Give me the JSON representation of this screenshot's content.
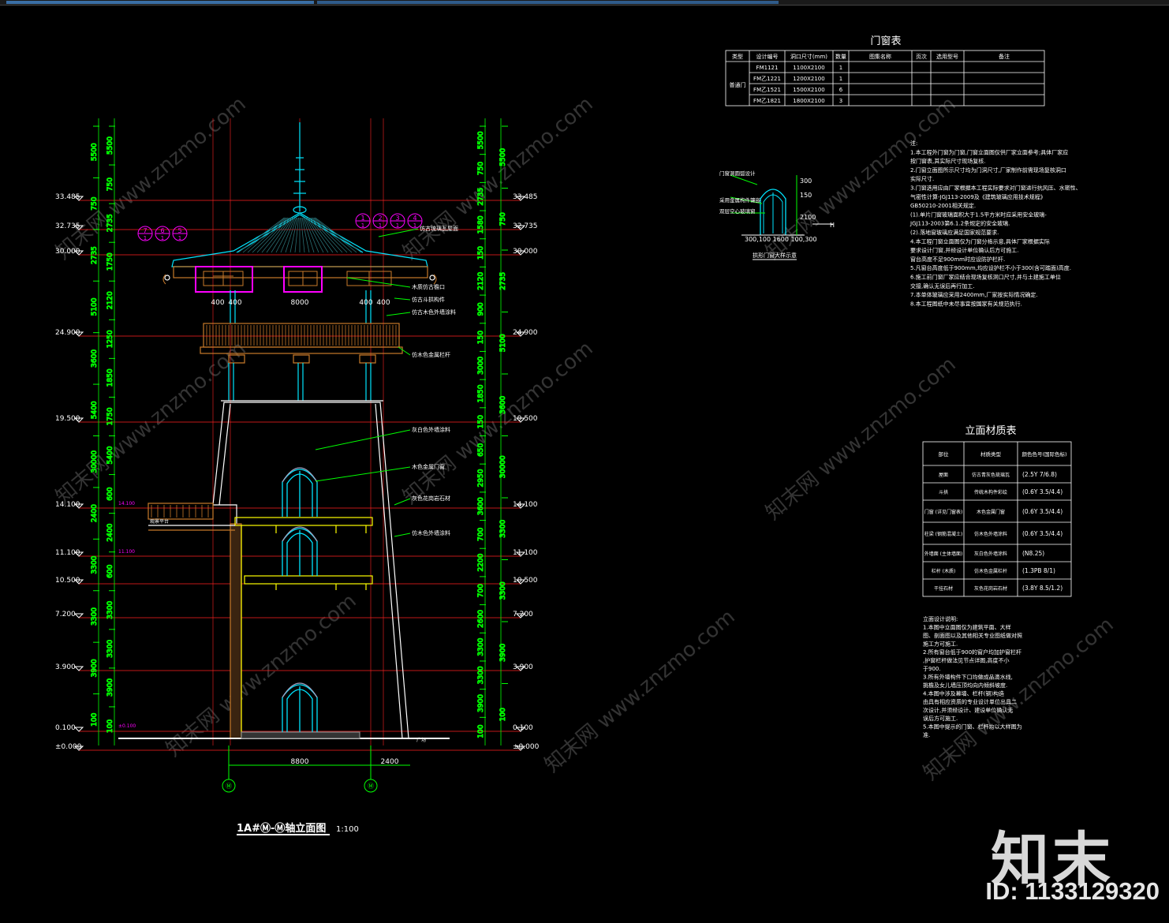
{
  "drawing_title": "1A#Ⓜ-Ⓜ轴立面图",
  "drawing_scale": "1:100",
  "door_table": {
    "title": "门窗表",
    "headers": [
      "类型",
      "设计编号",
      "洞口尺寸(mm)",
      "数量",
      "图集名称",
      "页次",
      "选用型号",
      "备注"
    ],
    "type": "普通门",
    "rows": [
      {
        "code": "FM1121",
        "size": "1100X2100",
        "qty": "1"
      },
      {
        "code": "FM乙1221",
        "size": "1200X2100",
        "qty": "1"
      },
      {
        "code": "FM乙1521",
        "size": "1500X2100",
        "qty": "6"
      },
      {
        "code": "FM乙1821",
        "size": "1800X2100",
        "qty": "3"
      }
    ]
  },
  "door_detail": {
    "title": "拱形门窗大样示意",
    "label_top": "门窗洞圆弧设计",
    "label_mid": "采用金属构件镶嵌",
    "label_low": "双层空心玻璃窗",
    "dims_bottom": "300,100 1600 100,300",
    "dims_right": [
      "300",
      "150",
      "2100"
    ],
    "h_mark": "H"
  },
  "notes": {
    "lines": [
      "注:",
      "1.本工程外门窗为门窗,门窗立面图仅供厂家立面参考;具体厂家应",
      "  按门窗表,其实际尺寸现场复核.",
      "2.门窗立面图所示尺寸均为门洞尺寸,厂家制作前需现场复核洞口",
      "  实际尺寸.",
      "3.门窗选用应由厂家根据本工程实际要求对门窗进行抗风压、水密性、",
      "  气密性计算-JGJ113-2009及《建筑玻璃应用技术规程》",
      "  GB50210-2001相关规定.",
      "  (1).单片门窗玻璃面积大于1.5平方米时应采用安全玻璃-",
      "  JGJ113-2003第6.1.2条规定的安全玻璃.",
      "  (2).落地窗玻璃应满足国家规范要求.",
      "4.本工程门窗立面图仅为门窗分格示意,具体厂家根据实际",
      "  要求设计门窗,并经设计单位确认后方可施工.",
      "  窗台高度不足900mm时应设防护栏杆.",
      "5.凡窗台高度低于900mm,均应设护栏不小于300(含可踏面)高度.",
      "6.施工前门窗厂家应结合现场复核洞口尺寸,并与土建施工单位",
      "  交接,确认无误后再行加工.",
      "7.本单体玻璃应采用2400mm,厂家按实际情况确定.",
      "8.本工程图纸中未尽事宜按国家有关规范执行."
    ]
  },
  "material_table": {
    "title": "立面材质表",
    "headers": [
      "部位",
      "材质类型",
      "颜色色号(国际色标)"
    ],
    "rows": [
      {
        "part": "屋面",
        "material": "仿古青灰色琉璃瓦",
        "color": "(2.5Y 7/6.8)"
      },
      {
        "part": "斗拱",
        "material": "传统木构件彩绘",
        "color": "(0.6Y 3.5/4.4)"
      },
      {
        "part": "门窗 (详见门窗表)",
        "material": "木色金属门窗",
        "color": "(0.6Y 3.5/4.4)"
      },
      {
        "part": "柱梁 (钢筋混凝土)",
        "material": "仿木色外墙涂料",
        "color": "(0.6Y 3.5/4.4)"
      },
      {
        "part": "外墙面 (主体墙面)",
        "material": "灰白色外墙涂料",
        "color": "(N8.25)"
      },
      {
        "part": "栏杆 (木质)",
        "material": "仿木色金属栏杆",
        "color": "(1.3PB 8/1)"
      },
      {
        "part": "干挂石材",
        "material": "灰色花岗岩石材",
        "color": "(3.8Y 8.5/1.2)"
      }
    ]
  },
  "design_notes": {
    "lines": [
      "立面设计说明:",
      "1.本图中立面图仅为建筑平面、大样",
      "图、剖面图以及其他相关专业图纸做对照",
      "施工方可施工.",
      "2.所有窗台低于900的窗户均加护窗栏杆",
      ",护窗栏杆做法见节点详图,高度不小",
      "于900.",
      "3.所有外墙构件下口均做成品滴水线,",
      "挑檐及女儿墙压顶均向内倾斜坡度.",
      "4.本图中涉及幕墙、栏杆(钢)构造",
      "由具有相应资质的专业设计单位出具二",
      "次设计,并须经设计、建设单位确认无",
      "误后方可施工.",
      "5.本图中提示的门窗、栏杆均以大样图为",
      "准."
    ]
  },
  "elevation": {
    "levels_left": [
      "33.485",
      "32.735",
      "30.000",
      "24.900",
      "19.500",
      "14.100",
      "11.100",
      "10.500",
      "7.200",
      "3.900",
      "0.100",
      "±0.000"
    ],
    "levels_right": [
      "33.485",
      "32.735",
      "30.000",
      "24.900",
      "19.500",
      "14.100",
      "11.100",
      "10.500",
      "7.200",
      "3.900",
      "0.100",
      "±0.000"
    ],
    "dims_left_outer": [
      "5500",
      "750",
      "2735",
      "5100",
      "3600",
      "5400",
      "30000",
      "2400",
      "3300",
      "3300",
      "3900",
      "100"
    ],
    "dims_left_inner": [
      "5500",
      "750",
      "2735",
      "1750",
      "2120",
      "1250",
      "1850",
      "1750",
      "5400",
      "600",
      "2400",
      "600",
      "3300",
      "3300",
      "3900",
      "100"
    ],
    "dims_right_outer": [
      "5500",
      "750",
      "2735",
      "5100",
      "3600",
      "30000",
      "3300",
      "3300",
      "3900",
      "100"
    ],
    "dims_right_inner": [
      "5500",
      "750",
      "2735",
      "1580",
      "150",
      "2120",
      "900",
      "150",
      "3000",
      "1850",
      "150",
      "650",
      "2950",
      "3600",
      "700",
      "2200",
      "700",
      "2600",
      "3300",
      "3300",
      "3900",
      "100"
    ],
    "top_dims": [
      "400",
      "400",
      "8000",
      "400",
      "400"
    ],
    "bottom_dims": [
      "8800",
      "2400"
    ],
    "axis_left": "Ⓜ",
    "axis_right": "Ⓜ",
    "callouts_left": [
      "7",
      "6",
      "5"
    ],
    "callouts_right": [
      "1",
      "2",
      "3",
      "4"
    ],
    "callout_sub": "1",
    "inner_marks": [
      "±0.100",
      "14.100",
      "11.100"
    ],
    "label_terrace": "观景平台",
    "label_ground": "广场",
    "leaders": [
      "仿古琉璃瓦屋面",
      "木质仿古檐口",
      "仿古斗拱构件",
      "仿古木色外墙涂料",
      "灰白色外墙涂料",
      "木色金属门窗",
      "灰色花岗岩石材",
      "仿木色金属栏杆",
      "仿木色外墙涂料"
    ]
  },
  "watermark": {
    "logo": "知末",
    "id": "ID: 1133129320",
    "tile_text": "知末网 www.znzmo.com"
  },
  "colors": {
    "green": "#00ff00",
    "red": "#ff2020",
    "cyan": "#00e5ff",
    "yellow": "#ffff00",
    "magenta": "#ff00ff",
    "white": "#ffffff",
    "orange": "#c87a2a"
  }
}
